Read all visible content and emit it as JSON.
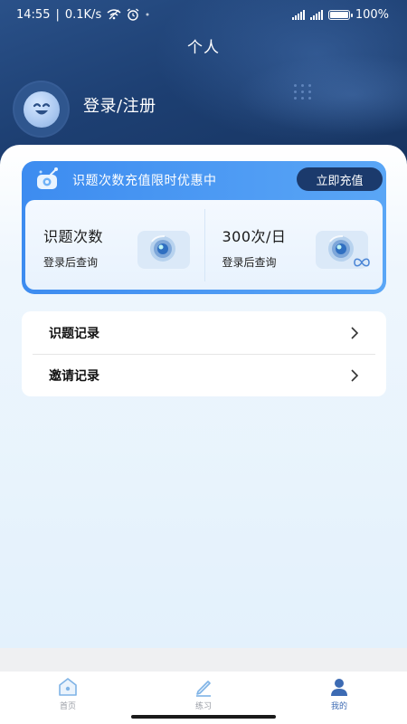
{
  "status_bar": {
    "time": "14:55",
    "network_speed": "0.1K/s",
    "battery": "100%"
  },
  "header": {
    "title": "个人",
    "login_label": "登录/注册"
  },
  "vip_card": {
    "promo_text": "识题次数充值限时优惠中",
    "recharge_button": "立即充值",
    "cells": [
      {
        "value": "识题次数",
        "sub": "登录后查询"
      },
      {
        "value": "300次/日",
        "sub": "登录后查询"
      }
    ]
  },
  "menu": {
    "items": [
      {
        "label": "识题记录"
      },
      {
        "label": "邀请记录"
      }
    ]
  },
  "bottom_nav": {
    "items": [
      {
        "label": "首页",
        "icon": "home-icon"
      },
      {
        "label": "练习",
        "icon": "pencil-icon"
      },
      {
        "label": "我的",
        "icon": "person-icon"
      }
    ],
    "active_index": 2
  },
  "colors": {
    "header_bg": "#1d3f72",
    "accent_blue": "#3d8cf0",
    "button_dark": "#1b3a6c",
    "nav_active": "#3d6bb3"
  }
}
